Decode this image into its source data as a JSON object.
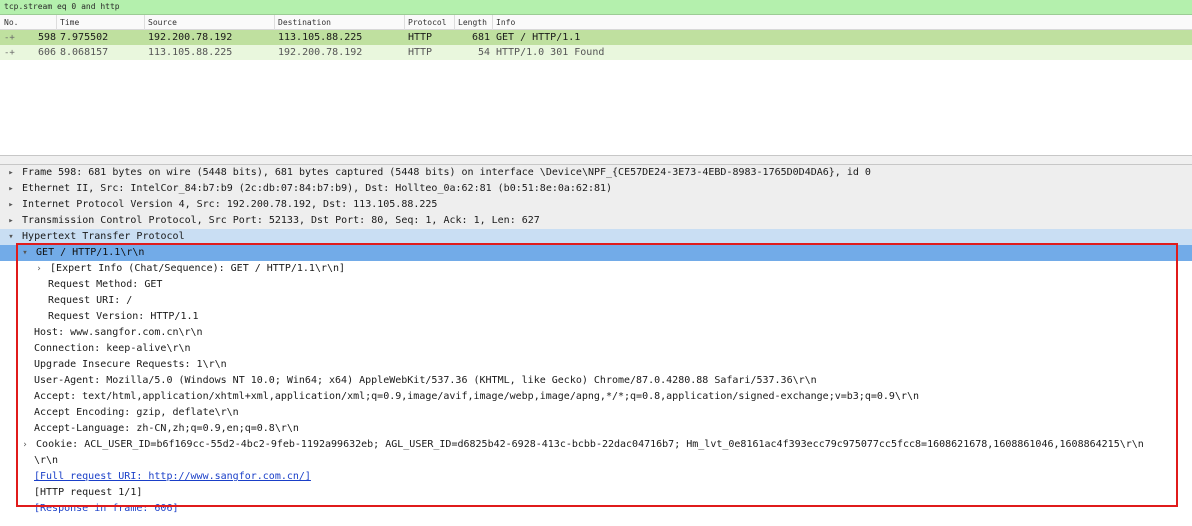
{
  "filter": {
    "value": "tcp.stream eq 0 and http"
  },
  "packet_list": {
    "columns": [
      "No.",
      "Time",
      "Source",
      "Destination",
      "Protocol",
      "Length",
      "Info"
    ],
    "rows": [
      {
        "no": "598",
        "time": "7.975502",
        "source": "192.200.78.192",
        "destination": "113.105.88.225",
        "protocol": "HTTP",
        "length": "681",
        "info": "GET / HTTP/1.1",
        "relation": "-+"
      },
      {
        "no": "606",
        "time": "8.068157",
        "source": "113.105.88.225",
        "destination": "192.200.78.192",
        "protocol": "HTTP",
        "length": "54",
        "info": "HTTP/1.0 301 Found",
        "relation": "-+"
      }
    ]
  },
  "details": {
    "frame": "Frame 598: 681 bytes on wire (5448 bits), 681 bytes captured (5448 bits) on interface \\Device\\NPF_{CE57DE24-3E73-4EBD-8983-1765D0D4DA6}, id 0",
    "ethernet": "Ethernet II, Src: IntelCor_84:b7:b9 (2c:db:07:84:b7:b9), Dst: Hollteo_0a:62:81 (b0:51:8e:0a:62:81)",
    "ip": "Internet Protocol Version 4, Src: 192.200.78.192, Dst: 113.105.88.225",
    "tcp": "Transmission Control Protocol, Src Port: 52133, Dst Port: 80, Seq: 1, Ack: 1, Len: 627",
    "http": "Hypertext Transfer Protocol",
    "get_line": "GET / HTTP/1.1\\r\\n",
    "expert_info": "[Expert Info (Chat/Sequence): GET / HTTP/1.1\\r\\n]",
    "request_method": "Request Method: GET",
    "request_uri": "Request URI: /",
    "request_version": "Request Version: HTTP/1.1",
    "host": "Host: www.sangfor.com.cn\\r\\n",
    "connection": "Connection: keep-alive\\r\\n",
    "upgrade": "Upgrade Insecure Requests: 1\\r\\n",
    "user_agent": "User-Agent: Mozilla/5.0 (Windows NT 10.0; Win64; x64) AppleWebKit/537.36 (KHTML, like Gecko) Chrome/87.0.4280.88 Safari/537.36\\r\\n",
    "accept": "Accept: text/html,application/xhtml+xml,application/xml;q=0.9,image/avif,image/webp,image/apng,*/*;q=0.8,application/signed-exchange;v=b3;q=0.9\\r\\n",
    "accept_encoding": "Accept Encoding: gzip, deflate\\r\\n",
    "accept_language": "Accept-Language: zh-CN,zh;q=0.9,en;q=0.8\\r\\n",
    "cookie": "Cookie: ACL_USER_ID=b6f169cc-55d2-4bc2-9feb-1192a99632eb; AGL_USER_ID=d6825b42-6928-413c-bcbb-22dac04716b7; Hm_lvt_0e8161ac4f393ecc79c975077cc5fcc8=1608621678,1608861046,1608864215\\r\\n",
    "crlf": "\\r\\n",
    "full_uri": "[Full request URI: http://www.sangfor.com.cn/]",
    "http_request": "[HTTP request 1/1]",
    "response_frame": "[Response in frame: 606]"
  },
  "icons": {
    "expanded": "triangle-down",
    "collapsed": "triangle-right"
  },
  "colors": {
    "filter_bg": "#b4f0ad",
    "selected_row": "#bfe09f",
    "highlight": "#72abe8",
    "annotation": "#e01b1b"
  }
}
